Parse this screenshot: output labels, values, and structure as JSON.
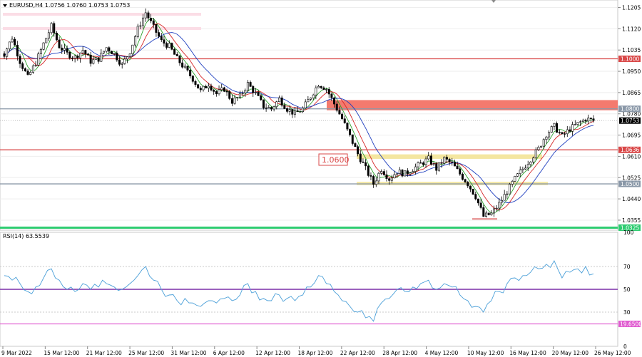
{
  "chart_data": [
    {
      "type": "candlestick",
      "title": "EURUSD,H4  1.0756 1.0760 1.0753 1.0753",
      "symbol": "EURUSD,H4",
      "ohlc_header": "1.0756 1.0760 1.0753 1.0753",
      "current_price": "1.0753",
      "ylim": [
        1.0315,
        1.1235
      ],
      "y_ticks": [
        "1.1205",
        "1.1120",
        "1.1035",
        "1.0950",
        "1.0865",
        "1.0780",
        "1.0695",
        "1.0610",
        "1.0525",
        "1.0440",
        "1.0355"
      ],
      "x_ticks": [
        "9 Mar 2022",
        "15 Mar 12:00",
        "21 Mar 12:00",
        "25 Mar 12:00",
        "31 Mar 12:00",
        "6 Apr 12:00",
        "12 Apr 12:00",
        "18 Apr 12:00",
        "22 Apr 12:00",
        "28 Apr 12:00",
        "4 May 12:00",
        "10 May 12:00",
        "16 May 12:00",
        "20 May 12:00",
        "26 May 12:00"
      ],
      "levels": [
        {
          "label": "1.1000",
          "value": 1.1,
          "color": "#d94848"
        },
        {
          "label": "1.0800",
          "value": 1.08,
          "color": "#8a98a8"
        },
        {
          "label": "1.0636",
          "value": 1.0636,
          "color": "#d94848"
        },
        {
          "label": "1.0500",
          "value": 1.05,
          "color": "#8a98a8"
        },
        {
          "label": "1.0325",
          "value": 1.0325,
          "color": "#2ecc71"
        }
      ],
      "annotation": "1.0600",
      "close_series": [
        1.102,
        1.1085,
        1.099,
        1.0925,
        1.0985,
        1.106,
        1.113,
        1.105,
        1.102,
        1.1005,
        1.1035,
        1.099,
        1.1,
        1.1045,
        1.102,
        1.0975,
        1.103,
        1.112,
        1.1185,
        1.1125,
        1.107,
        1.105,
        1.1,
        1.096,
        1.092,
        1.087,
        1.09,
        1.086,
        1.088,
        1.083,
        1.085,
        1.09,
        1.086,
        1.081,
        1.08,
        1.084,
        1.08,
        1.078,
        1.08,
        1.085,
        1.09,
        1.088,
        1.082,
        1.076,
        1.069,
        1.062,
        1.056,
        1.05,
        1.056,
        1.052,
        1.055,
        1.054,
        1.056,
        1.058,
        1.06,
        1.056,
        1.06,
        1.058,
        1.054,
        1.05,
        1.045,
        1.037,
        1.038,
        1.042,
        1.047,
        1.052,
        1.056,
        1.06,
        1.064,
        1.07,
        1.073,
        1.069,
        1.072,
        1.074,
        1.076,
        1.0753
      ],
      "ma_fast_color": "#2ca02c",
      "ma_mid_color": "#d62728",
      "ma_slow_color": "#1f3fbf"
    },
    {
      "type": "line",
      "title": "RSI(14) 63.5539",
      "ylim": [
        0,
        100
      ],
      "y_ticks": [
        "100",
        "70",
        "50",
        "30",
        "0"
      ],
      "levels": [
        {
          "label": "50",
          "value": 50,
          "color": "#7b2fa8"
        },
        {
          "label": "19.6500",
          "value": 19.65,
          "color": "#e05bd0"
        }
      ],
      "values": [
        62,
        58,
        55,
        48,
        52,
        60,
        68,
        58,
        50,
        48,
        55,
        50,
        52,
        55,
        52,
        50,
        55,
        62,
        70,
        58,
        50,
        45,
        40,
        42,
        38,
        35,
        40,
        38,
        42,
        40,
        45,
        55,
        48,
        42,
        40,
        45,
        42,
        40,
        45,
        52,
        62,
        55,
        48,
        40,
        35,
        30,
        25,
        22,
        38,
        42,
        50,
        48,
        52,
        55,
        58,
        50,
        55,
        52,
        45,
        40,
        35,
        30,
        40,
        48,
        55,
        60,
        62,
        65,
        68,
        72,
        75,
        60,
        65,
        68,
        70,
        63.55
      ],
      "line_color": "#4a9fd8"
    }
  ]
}
